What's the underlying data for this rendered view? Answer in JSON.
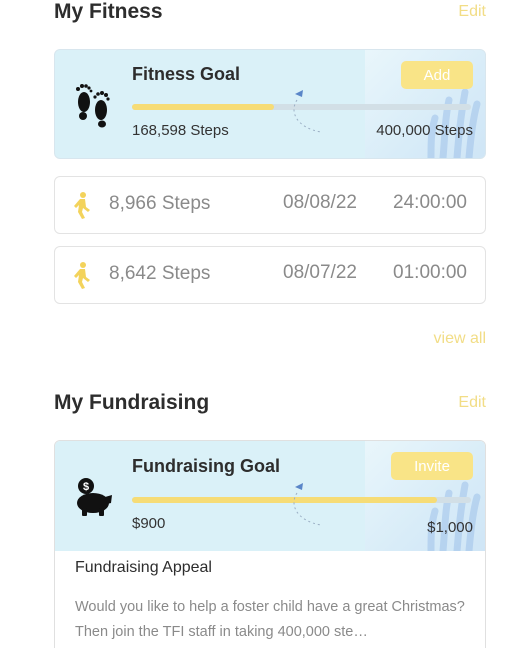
{
  "fitness": {
    "section_title": "My Fitness",
    "edit_label": "Edit",
    "goal": {
      "title": "Fitness Goal",
      "button_label": "Add",
      "current_label": "168,598 Steps",
      "target_label": "400,000 Steps",
      "progress": 0.42
    },
    "entries": [
      {
        "steps": "8,966 Steps",
        "date": "08/08/22",
        "time": "24:00:00"
      },
      {
        "steps": "8,642 Steps",
        "date": "08/07/22",
        "time": "01:00:00"
      }
    ],
    "view_all_label": "view all"
  },
  "fundraising": {
    "section_title": "My Fundraising",
    "edit_label": "Edit",
    "goal": {
      "title": "Fundraising Goal",
      "button_label": "Invite",
      "current_label": "$900",
      "target_label": "$1,000",
      "progress": 0.9
    },
    "appeal_title": "Fundraising Appeal",
    "appeal_text": "Would you like to help a foster child have a great Christmas? Then join the TFI staff in taking 400,000 ste…"
  },
  "colors": {
    "accent_yellow": "#f6dc76",
    "card_blue": "#daf1f8",
    "muted_text": "#8a8a8a"
  },
  "icons": {
    "footprints": "footprints-icon",
    "walker": "walking-person-icon",
    "piggy_bank": "piggy-bank-icon"
  }
}
